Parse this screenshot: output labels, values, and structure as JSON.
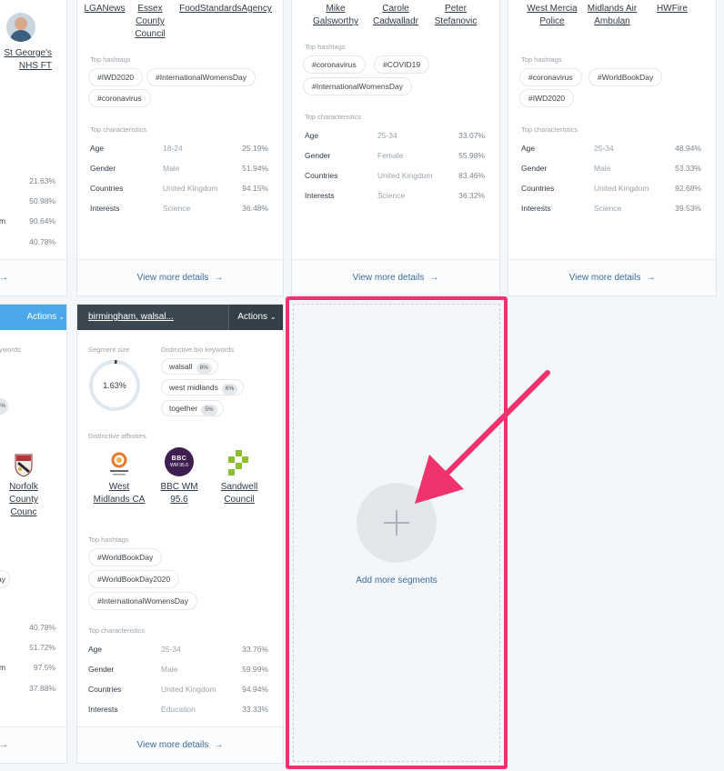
{
  "card_left": {
    "affinity": "St George's NHS FT",
    "pcts": [
      "21.63%",
      "50.98%",
      "90.64%",
      "40.78%"
    ],
    "arrow": "→"
  },
  "card_lga": {
    "affinities": [
      "LGANews",
      "Essex County Council",
      "FoodStandardsAgency"
    ],
    "top_hashtags_label": "Top hashtags",
    "hashtags": [
      "#IWD2020",
      "#InternationalWomensDay",
      "#coronavirus"
    ],
    "top_characteristics_label": "Top characteristics",
    "characteristics": [
      {
        "k": "Age",
        "v": "18-24",
        "p": "25.19%"
      },
      {
        "k": "Gender",
        "v": "Male",
        "p": "51.94%"
      },
      {
        "k": "Countries",
        "v": "United Kingdom",
        "p": "94.15%"
      },
      {
        "k": "Interests",
        "v": "Science",
        "p": "36.48%"
      }
    ],
    "view_more": "View more details"
  },
  "card_mike": {
    "affinities": [
      "Mike Galsworthy",
      "Carole Cadwalladr",
      "Peter Stefanovic"
    ],
    "top_hashtags_label": "Top hashtags",
    "hashtags": [
      "#coronavirus",
      "#COVID19",
      "#InternationalWomensDay"
    ],
    "top_characteristics_label": "Top characteristics",
    "characteristics": [
      {
        "k": "Age",
        "v": "25-34",
        "p": "33.07%"
      },
      {
        "k": "Gender",
        "v": "Female",
        "p": "55.98%"
      },
      {
        "k": "Countries",
        "v": "United Kingdom",
        "p": "83.46%"
      },
      {
        "k": "Interests",
        "v": "Science",
        "p": "36.32%"
      }
    ],
    "view_more": "View more details"
  },
  "card_west": {
    "affinities": [
      "West Mercia Police",
      "Midlands Air Ambulan",
      "HWFire"
    ],
    "top_hashtags_label": "Top hashtags",
    "hashtags": [
      "#coronavirus",
      "#WorldBookDay",
      "#IWD2020"
    ],
    "top_characteristics_label": "Top characteristics",
    "characteristics": [
      {
        "k": "Age",
        "v": "25-34",
        "p": "48.94%"
      },
      {
        "k": "Gender",
        "v": "Male",
        "p": "53.33%"
      },
      {
        "k": "Countries",
        "v": "United Kingdom",
        "p": "92.68%"
      },
      {
        "k": "Interests",
        "v": "Science",
        "p": "39.53%"
      }
    ],
    "view_more": "View more details"
  },
  "card_left2": {
    "actions": "Actions",
    "keywords_label_cut": "ywords",
    "tag_cut": "%",
    "affinity": "Norfolk County Counc",
    "hashtag_cut": "ay",
    "pcts": [
      "40.78%",
      "51.72%",
      "97.5%",
      "37.88%"
    ],
    "arrow": "→"
  },
  "card_birmingham": {
    "segment_name": "birmingham, walsal...",
    "actions": "Actions",
    "segment_size_label": "Segment size",
    "segment_size_pct": "1.63%",
    "segment_fraction": 0.0163,
    "keywords_label": "Distinctive bio keywords",
    "keywords": [
      {
        "word": "walsall",
        "pct": "8%"
      },
      {
        "word": "west midlands",
        "pct": "6%"
      },
      {
        "word": "together",
        "pct": "5%"
      }
    ],
    "affinities_label": "Distinctive affinities",
    "affinities": [
      "West Midlands CA",
      "BBC WM 95.6",
      "Sandwell Council"
    ],
    "bbc_logo_text": "BBC",
    "bbc_logo_sub": "WM 95.6",
    "top_hashtags_label": "Top hashtags",
    "hashtags": [
      "#WorldBookDay",
      "#WorldBookDay2020",
      "#InternationalWomensDay"
    ],
    "top_characteristics_label": "Top characteristics",
    "characteristics": [
      {
        "k": "Age",
        "v": "25-34",
        "p": "33.76%"
      },
      {
        "k": "Gender",
        "v": "Male",
        "p": "59.99%"
      },
      {
        "k": "Countries",
        "v": "United Kingdom",
        "p": "94.94%"
      },
      {
        "k": "Interests",
        "v": "Education",
        "p": "33.33%"
      }
    ],
    "view_more": "View more details"
  },
  "add_segment": {
    "label": "Add more segments",
    "icon": "plus-icon"
  },
  "colors": {
    "highlight": "#f0326e",
    "actions_blue": "#4aa8e8",
    "header_dark": "#3a4750",
    "link_blue": "#3d6b9a"
  }
}
